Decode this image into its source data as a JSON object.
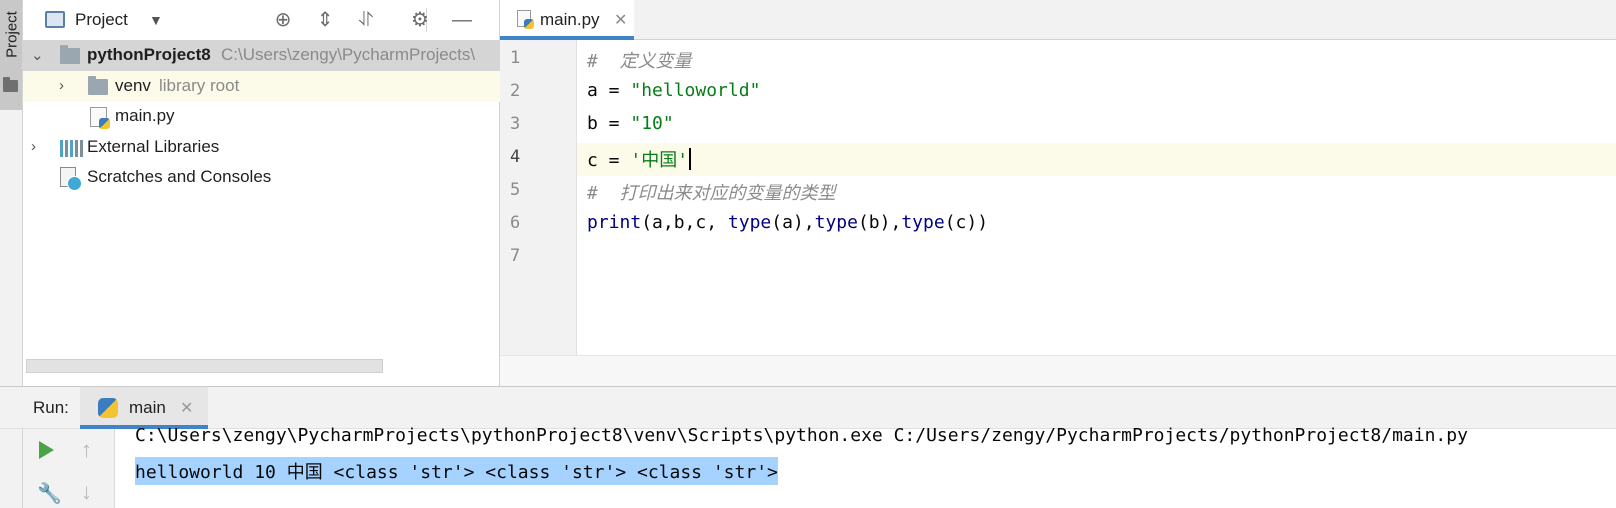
{
  "sidebar": {
    "tab_label": "Project"
  },
  "project_panel": {
    "title": "Project",
    "toolbar_icons": [
      "locate-icon",
      "expand-all-icon",
      "collapse-all-icon",
      "gear-icon",
      "minimize-icon"
    ],
    "tree": [
      {
        "label": "pythonProject8",
        "path": "C:\\Users\\zengy\\PycharmProjects\\",
        "icon": "folder-icon",
        "expanded": true
      },
      {
        "label": "venv",
        "path": "library root",
        "icon": "folder-icon",
        "expanded": false
      },
      {
        "label": "main.py",
        "path": "",
        "icon": "python-file-icon"
      },
      {
        "label": "External Libraries",
        "path": "",
        "icon": "libraries-icon",
        "expanded": false
      },
      {
        "label": "Scratches and Consoles",
        "path": "",
        "icon": "scratches-icon"
      }
    ]
  },
  "editor": {
    "tab_label": "main.py",
    "lines": [
      "1",
      "2",
      "3",
      "4",
      "5",
      "6",
      "7"
    ],
    "code": {
      "l1_comment": "#  定义变量",
      "l2_a": "a = ",
      "l2_str": "\"helloworld\"",
      "l3_b": "b = ",
      "l3_str": "\"10\"",
      "l4_c": "c = ",
      "l4_str": "'中国'",
      "l5_comment": "#  打印出来对应的变量的类型",
      "l6_print": "print",
      "l6_args1": "(a,b,c, ",
      "l6_type1": "type",
      "l6_args2": "(a),",
      "l6_type2": "type",
      "l6_args3": "(b),",
      "l6_type3": "type",
      "l6_args4": "(c))"
    },
    "current_line": 4
  },
  "run_panel": {
    "title": "Run:",
    "tab_label": "main",
    "output": [
      "C:\\Users\\zengy\\PycharmProjects\\pythonProject8\\venv\\Scripts\\python.exe C:/Users/zengy/PycharmProjects/pythonProject8/main.py",
      "helloworld 10 中国 <class 'str'> <class 'str'> <class 'str'>"
    ],
    "selection_color": "#a6d2ff"
  }
}
